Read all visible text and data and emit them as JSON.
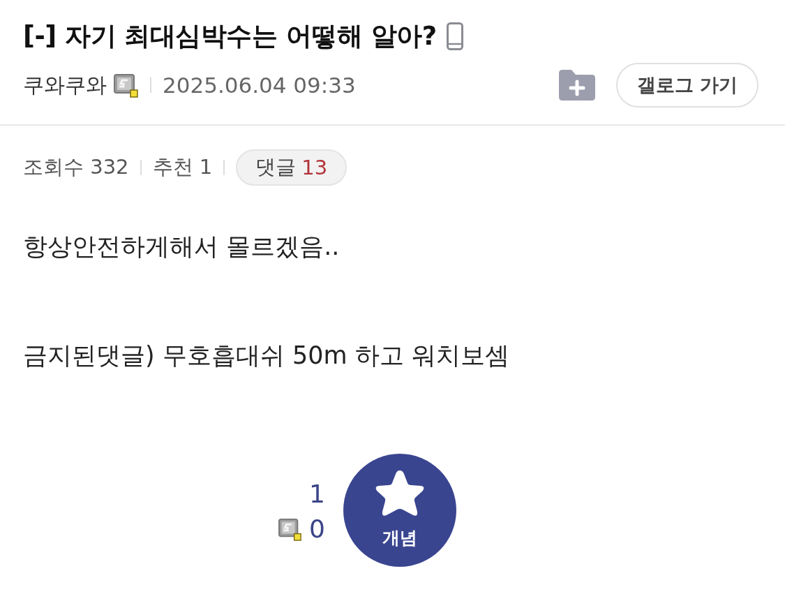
{
  "post": {
    "title": "[-] 자기 최대심박수는 어떻해 알아?",
    "author": "쿠와쿠와",
    "date": "2025.06.04 09:33",
    "gallog_button": "갤로그 가기",
    "stats": [
      {
        "kind": "plain",
        "label": "조회수",
        "value": "332"
      },
      {
        "kind": "plain",
        "label": "추천",
        "value": "1"
      },
      {
        "kind": "pill",
        "label": "댓글",
        "value": "13"
      }
    ],
    "body": [
      "항상안전하게해서 몰르겠음..",
      "금지된댓글) 무호흡대쉬 50m 하고 워치보셈"
    ],
    "vote": {
      "recommend_count": "1",
      "fixed_count": "0",
      "button_label": "개념"
    }
  }
}
